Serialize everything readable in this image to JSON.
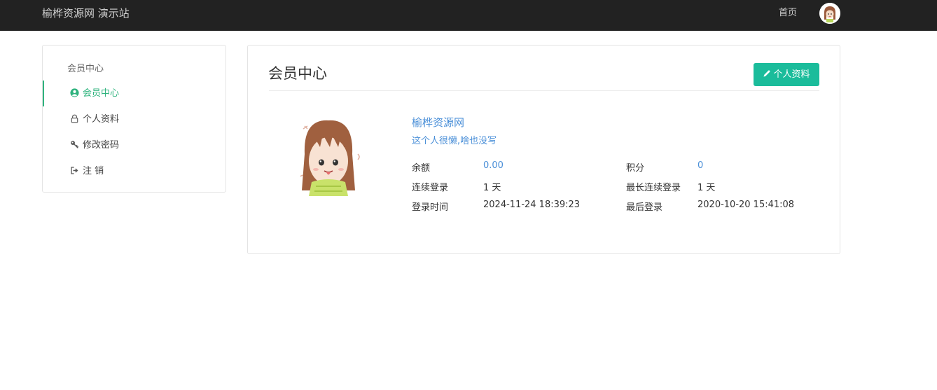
{
  "header": {
    "brand": "榆桦资源网 演示站",
    "nav_home": "首页"
  },
  "sidebar": {
    "title": "会员中心",
    "items": [
      {
        "label": "会员中心",
        "icon": "user-circle-icon",
        "active": true
      },
      {
        "label": "个人资料",
        "icon": "lock-icon",
        "active": false
      },
      {
        "label": "修改密码",
        "icon": "key-icon",
        "active": false
      },
      {
        "label": "注 销",
        "icon": "sign-out-icon",
        "active": false
      }
    ]
  },
  "main": {
    "title": "会员中心",
    "edit_button": "个人资料",
    "user_name": "榆桦资源网",
    "user_signature": "这个人很懒,啥也没写",
    "stats": {
      "balance_label": "余额",
      "balance_value": "0.00",
      "points_label": "积分",
      "points_value": "0",
      "streak_label": "连续登录",
      "streak_value": "1 天",
      "max_streak_label": "最长连续登录",
      "max_streak_value": "1 天",
      "login_time_label": "登录时间",
      "login_time_value": "2024-11-24 18:39:23",
      "last_login_label": "最后登录",
      "last_login_value": "2020-10-20 15:41:08"
    }
  },
  "colors": {
    "topbar": "#222222",
    "accent_green": "#2fb37e",
    "button_teal": "#1bbc9b",
    "link_blue": "#4a8fd8"
  }
}
